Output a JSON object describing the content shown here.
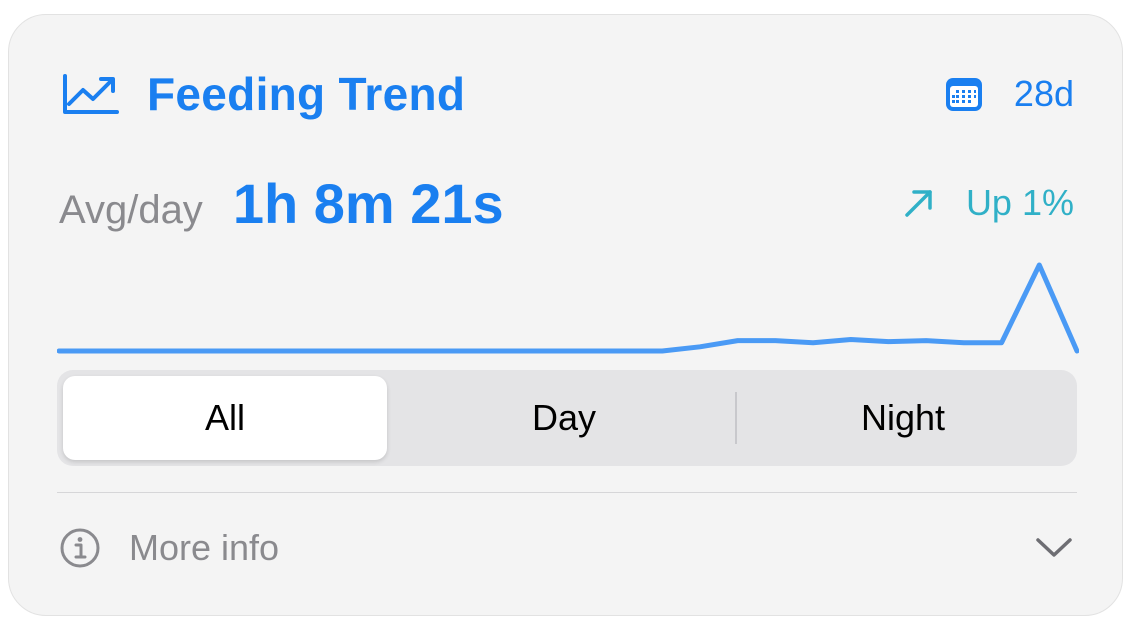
{
  "header": {
    "title": "Feeding Trend",
    "range_label": "28d",
    "trend_icon": "chart-line-uptrend-icon",
    "calendar_icon": "calendar-icon"
  },
  "stats": {
    "avg_label": "Avg/day",
    "avg_value": "1h 8m 21s",
    "change_label": "Up 1%",
    "change_icon": "arrow-up-right-icon"
  },
  "sparkline": {
    "values": [
      0,
      0,
      0,
      0,
      0,
      0,
      0,
      0,
      0,
      0,
      0,
      0,
      0,
      0,
      0,
      0,
      0,
      0.8,
      2,
      2,
      1.6,
      2.2,
      1.8,
      2,
      1.6,
      1.6,
      16.5,
      0
    ]
  },
  "segments": {
    "items": [
      "All",
      "Day",
      "Night"
    ],
    "selected": "All"
  },
  "footer": {
    "more_info_label": "More info",
    "info_icon": "info-circle-icon",
    "chevron_icon": "chevron-down-icon"
  },
  "colors": {
    "accent": "#1a7ff0",
    "sparkline": "#4a9af5",
    "trend_up": "#30b0c7",
    "secondary_text": "#8a8a8e",
    "card_background": "#f4f4f4"
  }
}
